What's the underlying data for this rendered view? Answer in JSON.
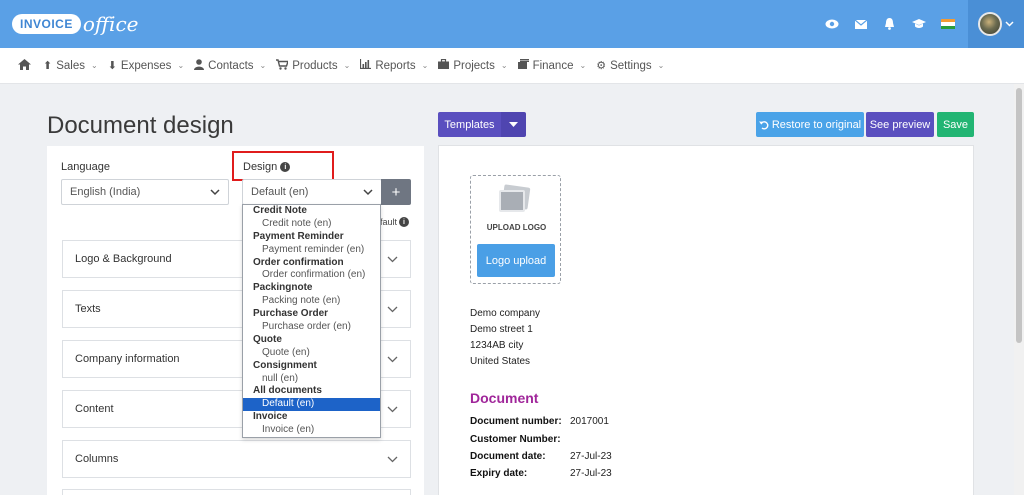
{
  "brand": {
    "badge": "INVOICE",
    "suffix": "office"
  },
  "nav": {
    "items": [
      {
        "label": "Sales",
        "icon": "arrow-up-icon"
      },
      {
        "label": "Expenses",
        "icon": "arrow-down-icon"
      },
      {
        "label": "Contacts",
        "icon": "user-icon"
      },
      {
        "label": "Products",
        "icon": "cart-icon"
      },
      {
        "label": "Reports",
        "icon": "chart-icon"
      },
      {
        "label": "Projects",
        "icon": "briefcase-icon"
      },
      {
        "label": "Finance",
        "icon": "money-icon"
      },
      {
        "label": "Settings",
        "icon": "gear-icon"
      }
    ]
  },
  "page": {
    "title": "Document design"
  },
  "form": {
    "language_label": "Language",
    "language_value": "English (India)",
    "design_label": "Design",
    "design_value": "Default (en)",
    "default_hint": "fault"
  },
  "dropdown": {
    "rows": [
      {
        "text": "Credit Note",
        "kind": "group"
      },
      {
        "text": "Credit note (en)",
        "kind": "option"
      },
      {
        "text": "Payment Reminder",
        "kind": "group"
      },
      {
        "text": "Payment reminder (en)",
        "kind": "option"
      },
      {
        "text": "Order confirmation",
        "kind": "group"
      },
      {
        "text": "Order confirmation (en)",
        "kind": "option"
      },
      {
        "text": "Packingnote",
        "kind": "group"
      },
      {
        "text": "Packing note (en)",
        "kind": "option"
      },
      {
        "text": "Purchase Order",
        "kind": "group"
      },
      {
        "text": "Purchase order (en)",
        "kind": "option"
      },
      {
        "text": "Quote",
        "kind": "group"
      },
      {
        "text": "Quote (en)",
        "kind": "option"
      },
      {
        "text": "Consignment",
        "kind": "group"
      },
      {
        "text": "null (en)",
        "kind": "option"
      },
      {
        "text": "All documents",
        "kind": "group"
      },
      {
        "text": "Default (en)",
        "kind": "option",
        "selected": true
      },
      {
        "text": "Invoice",
        "kind": "group"
      },
      {
        "text": "Invoice (en)",
        "kind": "option"
      }
    ]
  },
  "sections": {
    "logo_background": "Logo & Background",
    "texts": "Texts",
    "company_information": "Company information",
    "content": "Content",
    "columns": "Columns"
  },
  "toolbar": {
    "templates": "Templates",
    "restore": "Restore to original",
    "preview": "See preview",
    "save": "Save"
  },
  "preview": {
    "upload_logo": "UPLOAD LOGO",
    "logo_upload_button": "Logo upload",
    "address": [
      "Demo company",
      "Demo street 1",
      "1234AB city",
      "United States"
    ],
    "document_title": "Document",
    "meta": [
      {
        "label": "Document number:",
        "value": "2017001"
      },
      {
        "label": "Customer Number:",
        "value": ""
      },
      {
        "label": "Document date:",
        "value": "27-Jul-23"
      },
      {
        "label": "Expiry date:",
        "value": "27-Jul-23"
      }
    ]
  },
  "colors": {
    "topbar": "#5aa0e6",
    "purple_button": "#5a4fbf",
    "save_green": "#22b573",
    "restore_blue": "#4aa3e8",
    "selection_blue": "#1d63c8",
    "highlight_red": "#e01c1c",
    "document_title": "#a0269a"
  }
}
